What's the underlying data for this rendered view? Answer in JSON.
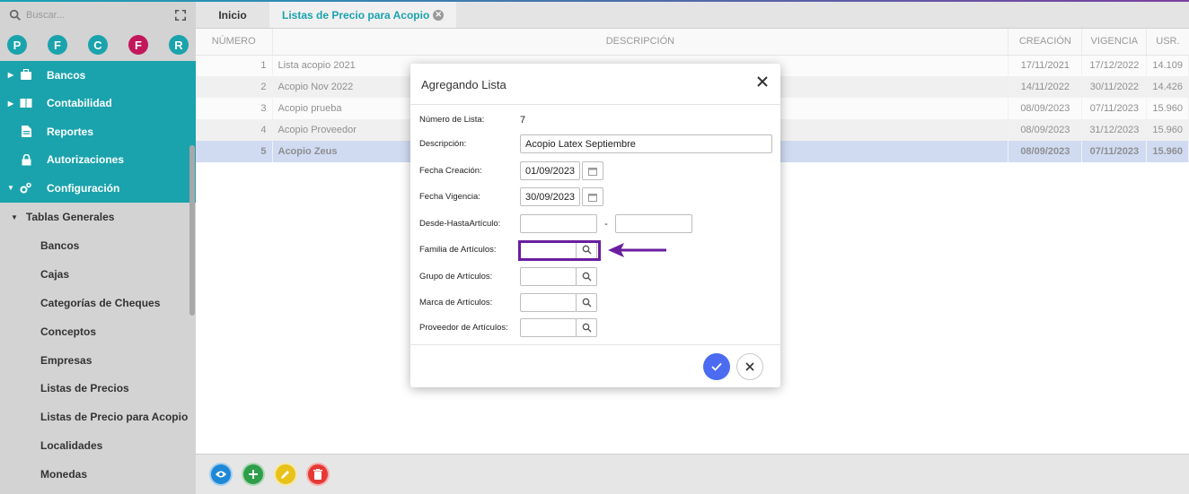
{
  "search": {
    "placeholder": "Buscar..."
  },
  "quick_buttons": [
    {
      "letter": "P",
      "color": "#1aa3ad"
    },
    {
      "letter": "F",
      "color": "#1aa3ad"
    },
    {
      "letter": "C",
      "color": "#1aa3ad"
    },
    {
      "letter": "F",
      "color": "#c2185b"
    },
    {
      "letter": "R",
      "color": "#1aa3ad"
    }
  ],
  "sidebar": {
    "menu": [
      {
        "label": "Bancos",
        "icon": "briefcase-icon"
      },
      {
        "label": "Contabilidad",
        "icon": "book-icon"
      },
      {
        "label": "Reportes",
        "icon": "file-icon"
      },
      {
        "label": "Autorizaciones",
        "icon": "lock-icon"
      },
      {
        "label": "Configuración",
        "icon": "cogs-icon"
      }
    ],
    "group": "Tablas Generales",
    "items": [
      "Bancos",
      "Cajas",
      "Categorías de Cheques",
      "Conceptos",
      "Empresas",
      "Listas de Precios",
      "Listas de Precio para Acopio",
      "Localidades",
      "Monedas"
    ]
  },
  "tabs": {
    "home": "Inicio",
    "active": "Listas de Precio para Acopio"
  },
  "table": {
    "headers": {
      "numero": "NÚMERO",
      "descripcion": "DESCRIPCIÓN",
      "creacion": "CREACIÓN",
      "vigencia": "VIGENCIA",
      "usr": "USR."
    },
    "rows": [
      {
        "numero": "1",
        "descripcion": "Lista acopio 2021",
        "creacion": "17/11/2021",
        "vigencia": "17/12/2022",
        "usr": "14.109"
      },
      {
        "numero": "2",
        "descripcion": "Acopio Nov 2022",
        "creacion": "14/11/2022",
        "vigencia": "30/11/2022",
        "usr": "14.426"
      },
      {
        "numero": "3",
        "descripcion": "Acopio prueba",
        "creacion": "08/09/2023",
        "vigencia": "07/11/2023",
        "usr": "15.960"
      },
      {
        "numero": "4",
        "descripcion": "Acopio Proveedor",
        "creacion": "08/09/2023",
        "vigencia": "31/12/2023",
        "usr": "15.960"
      },
      {
        "numero": "5",
        "descripcion": "Acopio Zeus",
        "creacion": "08/09/2023",
        "vigencia": "07/11/2023",
        "usr": "15.960"
      }
    ]
  },
  "modal": {
    "title": "Agregando Lista",
    "fields": {
      "numero_label": "Número de Lista:",
      "numero_value": "7",
      "descripcion_label": "Descripción:",
      "descripcion_value": "Acopio Latex Septiembre",
      "fecha_creacion_label": "Fecha Creación:",
      "fecha_creacion_value": "01/09/2023",
      "fecha_vigencia_label": "Fecha Vigencia:",
      "fecha_vigencia_value": "30/09/2023",
      "desde_hasta_label": "Desde-HastaArtículo:",
      "separator": "-",
      "familia_label": "Familia de Artículos:",
      "grupo_label": "Grupo de Artículos:",
      "marca_label": "Marca de Artículos:",
      "proveedor_label": "Proveedor de Artículos:"
    }
  },
  "colors": {
    "teal": "#1aa3ad",
    "selected_row": "#a9bde8",
    "annotation": "#6a1ea0",
    "confirm": "#4b6cf0"
  },
  "actions": [
    {
      "name": "view",
      "color": "#1e88d6",
      "icon": "eye-icon"
    },
    {
      "name": "add",
      "color": "#2e9e4a",
      "icon": "plus-icon"
    },
    {
      "name": "edit",
      "color": "#e8c21a",
      "icon": "pencil-icon"
    },
    {
      "name": "delete",
      "color": "#e53935",
      "icon": "trash-icon"
    }
  ]
}
